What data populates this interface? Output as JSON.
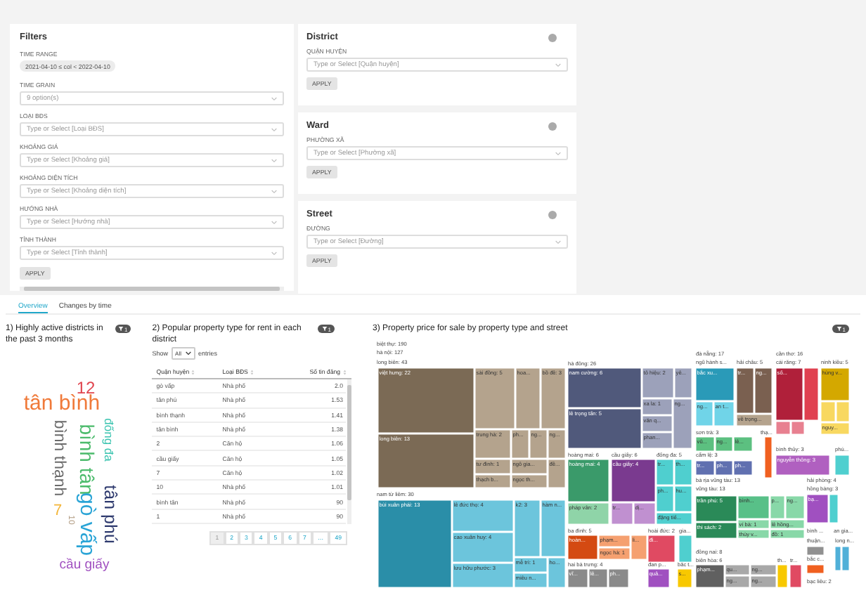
{
  "filters": {
    "title": "Filters",
    "fields": [
      {
        "kind": "chip",
        "label": "TIME RANGE",
        "value": "2021-04-10 ≤ col < 2022-04-10"
      },
      {
        "kind": "select",
        "label": "TIME GRAIN",
        "placeholder": "9 option(s)"
      },
      {
        "kind": "select",
        "label": "LOẠI BĐS",
        "placeholder": "Type or Select [Loại BĐS]"
      },
      {
        "kind": "select",
        "label": "KHOẢNG GIÁ",
        "placeholder": "Type or Select [Khoảng giá]"
      },
      {
        "kind": "select",
        "label": "KHOẢNG DIỆN TÍCH",
        "placeholder": "Type or Select [Khoảng diện tích]"
      },
      {
        "kind": "select",
        "label": "HƯỚNG NHÀ",
        "placeholder": "Type or Select [Hướng nhà]"
      },
      {
        "kind": "select",
        "label": "TỈNH THÀNH",
        "placeholder": "Type or Select [Tỉnh thành]"
      }
    ],
    "apply": "APPLY"
  },
  "side_filters": [
    {
      "title": "District",
      "label": "QUẬN HUYỆN",
      "placeholder": "Type or Select [Quận huyện]",
      "apply": "APPLY"
    },
    {
      "title": "Ward",
      "label": "PHƯỜNG XÃ",
      "placeholder": "Type or Select [Phường xã]",
      "apply": "APPLY"
    },
    {
      "title": "Street",
      "label": "ĐƯỜNG",
      "placeholder": "Type or Select [Đường]",
      "apply": "APPLY"
    }
  ],
  "tabs": [
    {
      "label": "Overview",
      "selected": true
    },
    {
      "label": "Changes by time",
      "selected": false
    }
  ],
  "wordcloud": {
    "title": "1) Highly active districts in the past 3 months",
    "filter_count": "1",
    "words": [
      {
        "text": "12",
        "color": "#e0454f",
        "vertical": false
      },
      {
        "text": "tân bình",
        "color": "#f07a3a",
        "vertical": false
      },
      {
        "text": "bình thạnh",
        "color": "#6b6b6b",
        "vertical": true
      },
      {
        "text": "bình tân",
        "color": "#4cbb6c",
        "vertical": true
      },
      {
        "text": "đống đa",
        "color": "#3cc4b0",
        "vertical": true
      },
      {
        "text": "gò vấp",
        "color": "#2aa4d6",
        "vertical": true
      },
      {
        "text": "tân phú",
        "color": "#2e3a6e",
        "vertical": true
      },
      {
        "text": "7",
        "color": "#f3b63b",
        "vertical": false
      },
      {
        "text": "10",
        "color": "#b09a80",
        "vertical": true
      },
      {
        "text": "cầu giấy",
        "color": "#a050c0",
        "vertical": false
      }
    ]
  },
  "table": {
    "title": "2) Popular property type for rent in each district",
    "filter_count": "1",
    "show_label": "Show",
    "length_value": "All",
    "entries_label": "entries",
    "columns": [
      "Quận huyện",
      "Loại BĐS",
      "Số tin đăng"
    ],
    "rows": [
      [
        "gò vấp",
        "Nhà phố",
        "2.0"
      ],
      [
        "tân phú",
        "Nhà phố",
        "1.53"
      ],
      [
        "bình thạnh",
        "Nhà phố",
        "1.41"
      ],
      [
        "tân bình",
        "Nhà phố",
        "1.38"
      ],
      [
        "2",
        "Căn hộ",
        "1.06"
      ],
      [
        "cầu giấy",
        "Căn hộ",
        "1.05"
      ],
      [
        "7",
        "Căn hộ",
        "1.02"
      ],
      [
        "10",
        "Nhà phố",
        "1.01"
      ],
      [
        "bình tân",
        "Nhà phố",
        "90"
      ],
      [
        "1",
        "Nhà phố",
        "90"
      ]
    ],
    "pages": [
      {
        "label": "1",
        "selected": true
      },
      {
        "label": "2",
        "selected": false
      },
      {
        "label": "3",
        "selected": false
      },
      {
        "label": "4",
        "selected": false
      },
      {
        "label": "5",
        "selected": false
      },
      {
        "label": "6",
        "selected": false
      },
      {
        "label": "7",
        "selected": false
      },
      {
        "label": "…",
        "selected": false
      },
      {
        "label": "49",
        "selected": false
      }
    ]
  },
  "treemap": {
    "title": "3) Property price for sale by property type and street",
    "filter_count": "1",
    "headers": [
      "biệt thự: 190",
      "hà nội: 127",
      "long biên: 43",
      "nam từ liêm: 30",
      "hà đông: 26",
      "hoàng mai: 6",
      "cầu giấy: 6",
      "đống đa: 5",
      "ba đình: 5",
      "hai bà trưng: 4",
      "hoài đức: 2",
      "gia...",
      "đan p...",
      "bắc t...",
      "đà nẵng: 17",
      "ngũ hành s...",
      "hải châu: 5",
      "cần thơ: 16",
      "cái răng: 7",
      "ninh kiều: 5",
      "sơn trà: 3",
      "thạ...",
      "cẩm lệ: 3",
      "bình thủy: 3",
      "phú...",
      "bà rịa vũng tàu: 13",
      "vũng tàu: 13",
      "hải phòng: 4",
      "hồng bàng: 3",
      "đồng nai: 8",
      "biên hòa: 6",
      "th...",
      "tr...",
      "bình ...",
      "an gia...",
      "thuận...",
      "long n...",
      "bắc c...",
      "bạc liêu: 2"
    ],
    "cells": [
      {
        "label": "việt hưng: 22",
        "color": "#7b6a55"
      },
      {
        "label": "long biên: 13",
        "color": "#7b6a55"
      },
      {
        "label": "sài đồng: 5",
        "color": "#b4a38d"
      },
      {
        "label": "hoa...",
        "color": "#b4a38d"
      },
      {
        "label": "bồ đề: 3",
        "color": "#b4a38d"
      },
      {
        "label": "trung hà: 2",
        "color": "#b4a38d"
      },
      {
        "label": "ph...",
        "color": "#b4a38d"
      },
      {
        "label": "ng...",
        "color": "#b4a38d"
      },
      {
        "label": "ng...",
        "color": "#b4a38d"
      },
      {
        "label": "tư đình: 1",
        "color": "#b4a38d"
      },
      {
        "label": "ngô gia...",
        "color": "#b4a38d"
      },
      {
        "label": "đề...",
        "color": "#b4a38d"
      },
      {
        "label": "thạch b...",
        "color": "#b4a38d"
      },
      {
        "label": "ngọc th...",
        "color": "#b4a38d"
      },
      {
        "label": "bùi xuân phái: 13",
        "color": "#2a8ea8"
      },
      {
        "label": "lê đức thọ: 4",
        "color": "#6cc5dc"
      },
      {
        "label": "cao xuân huy: 4",
        "color": "#6cc5dc"
      },
      {
        "label": "lưu hữu phước: 3",
        "color": "#6cc5dc"
      },
      {
        "label": "k2: 3",
        "color": "#6cc5dc"
      },
      {
        "label": "hàm n...",
        "color": "#6cc5dc"
      },
      {
        "label": "mễ trì: 1",
        "color": "#6cc5dc"
      },
      {
        "label": "miêu n...",
        "color": "#6cc5dc"
      },
      {
        "label": "ho...",
        "color": "#6cc5dc"
      },
      {
        "label": "nam cường: 6",
        "color": "#50597b"
      },
      {
        "label": "lê trọng tấn: 5",
        "color": "#50597b"
      },
      {
        "label": "tô hiệu: 2",
        "color": "#9ca1ba"
      },
      {
        "label": "yê...",
        "color": "#9ca1ba"
      },
      {
        "label": "xa la: 1",
        "color": "#9ca1ba"
      },
      {
        "label": "văn q...",
        "color": "#9ca1ba"
      },
      {
        "label": "phan...",
        "color": "#9ca1ba"
      },
      {
        "label": "ng...",
        "color": "#9ca1ba"
      },
      {
        "label": "hoàng mai: 4",
        "color": "#3a9a6a"
      },
      {
        "label": "pháp vân: 2",
        "color": "#8fd4a8"
      },
      {
        "label": "cầu giấy: 4",
        "color": "#7a3a8f"
      },
      {
        "label": "tr...",
        "color": "#c090d0"
      },
      {
        "label": "dị...",
        "color": "#c090d0"
      },
      {
        "label": "tr...",
        "color": "#4fcfcf"
      },
      {
        "label": "th...",
        "color": "#4fcfcf"
      },
      {
        "label": "ph...",
        "color": "#4fcfcf"
      },
      {
        "label": "hu...",
        "color": "#4fcfcf"
      },
      {
        "label": "đặng tiế...",
        "color": "#4fcfcf"
      },
      {
        "label": "hoàn...",
        "color": "#d44a12"
      },
      {
        "label": "phạm...",
        "color": "#f5a070"
      },
      {
        "label": "ngọc hà: 1",
        "color": "#f5a070"
      },
      {
        "label": "li...",
        "color": "#f5a070"
      },
      {
        "label": "vĩ...",
        "color": "#8a8a8a"
      },
      {
        "label": "lê...",
        "color": "#8a8a8a"
      },
      {
        "label": "ph...",
        "color": "#8a8a8a"
      },
      {
        "label": "đi...",
        "color": "#e04a62"
      },
      {
        "color": "#4fcfcf"
      },
      {
        "label": "quả...",
        "color": "#a050c0"
      },
      {
        "label": "s...",
        "color": "#f8c800"
      },
      {
        "label": "bắc xu...",
        "color": "#2a9ab8"
      },
      {
        "label": "ng...",
        "color": "#70d4e8"
      },
      {
        "label": "an t...",
        "color": "#70d4e8"
      },
      {
        "label": "tr...",
        "color": "#7a6050"
      },
      {
        "label": "ng...",
        "color": "#7a6050"
      },
      {
        "label": "về trọng...",
        "color": "#b5a38d"
      },
      {
        "label": "số...",
        "color": "#b0203a"
      },
      {
        "color": "#e04050"
      },
      {
        "color": "#e88090"
      },
      {
        "color": "#e88090"
      },
      {
        "label": "hùng v...",
        "color": "#d4a800"
      },
      {
        "color": "#f8d860"
      },
      {
        "color": "#f8d860"
      },
      {
        "label": "nguy...",
        "color": "#f8d860"
      },
      {
        "label": "vũ...",
        "color": "#5cc080"
      },
      {
        "label": "ng...",
        "color": "#5cc080"
      },
      {
        "label": "lê...",
        "color": "#5cc080"
      },
      {
        "color": "#f06020"
      },
      {
        "label": "tr...",
        "color": "#6070b0"
      },
      {
        "label": "ph...",
        "color": "#6070b0"
      },
      {
        "label": "ph...",
        "color": "#6070b0"
      },
      {
        "label": "nguyễn thông: 3",
        "color": "#b060c0"
      },
      {
        "color": "#4fcfcf"
      },
      {
        "label": "trần phú: 5",
        "color": "#2a8a58"
      },
      {
        "label": "thi sách: 2",
        "color": "#2a8a58"
      },
      {
        "label": "bình...",
        "color": "#58c088"
      },
      {
        "label": "p...",
        "color": "#88d8a8"
      },
      {
        "label": "ng...",
        "color": "#88d8a8"
      },
      {
        "label": "ví bà: 1",
        "color": "#88d8a8"
      },
      {
        "label": "lê hồng...",
        "color": "#88d8a8"
      },
      {
        "label": "thùy v...",
        "color": "#88d8a8"
      },
      {
        "label": "đồ: 1",
        "color": "#88d8a8"
      },
      {
        "label": "bạ...",
        "color": "#a050c0"
      },
      {
        "color": "#4fcfcf"
      },
      {
        "label": "phạm...",
        "color": "#606060"
      },
      {
        "label": "qu...",
        "color": "#a8a8a8"
      },
      {
        "label": "ng...",
        "color": "#a8a8a8"
      },
      {
        "label": "ng...",
        "color": "#a8a8a8"
      },
      {
        "label": "ng...",
        "color": "#a8a8a8"
      },
      {
        "color": "#f8c800"
      },
      {
        "color": "#e04a62"
      },
      {
        "color": "#909090"
      },
      {
        "color": "#50b0d8"
      },
      {
        "color": "#50b0d8"
      },
      {
        "color": "#f06020"
      }
    ]
  }
}
